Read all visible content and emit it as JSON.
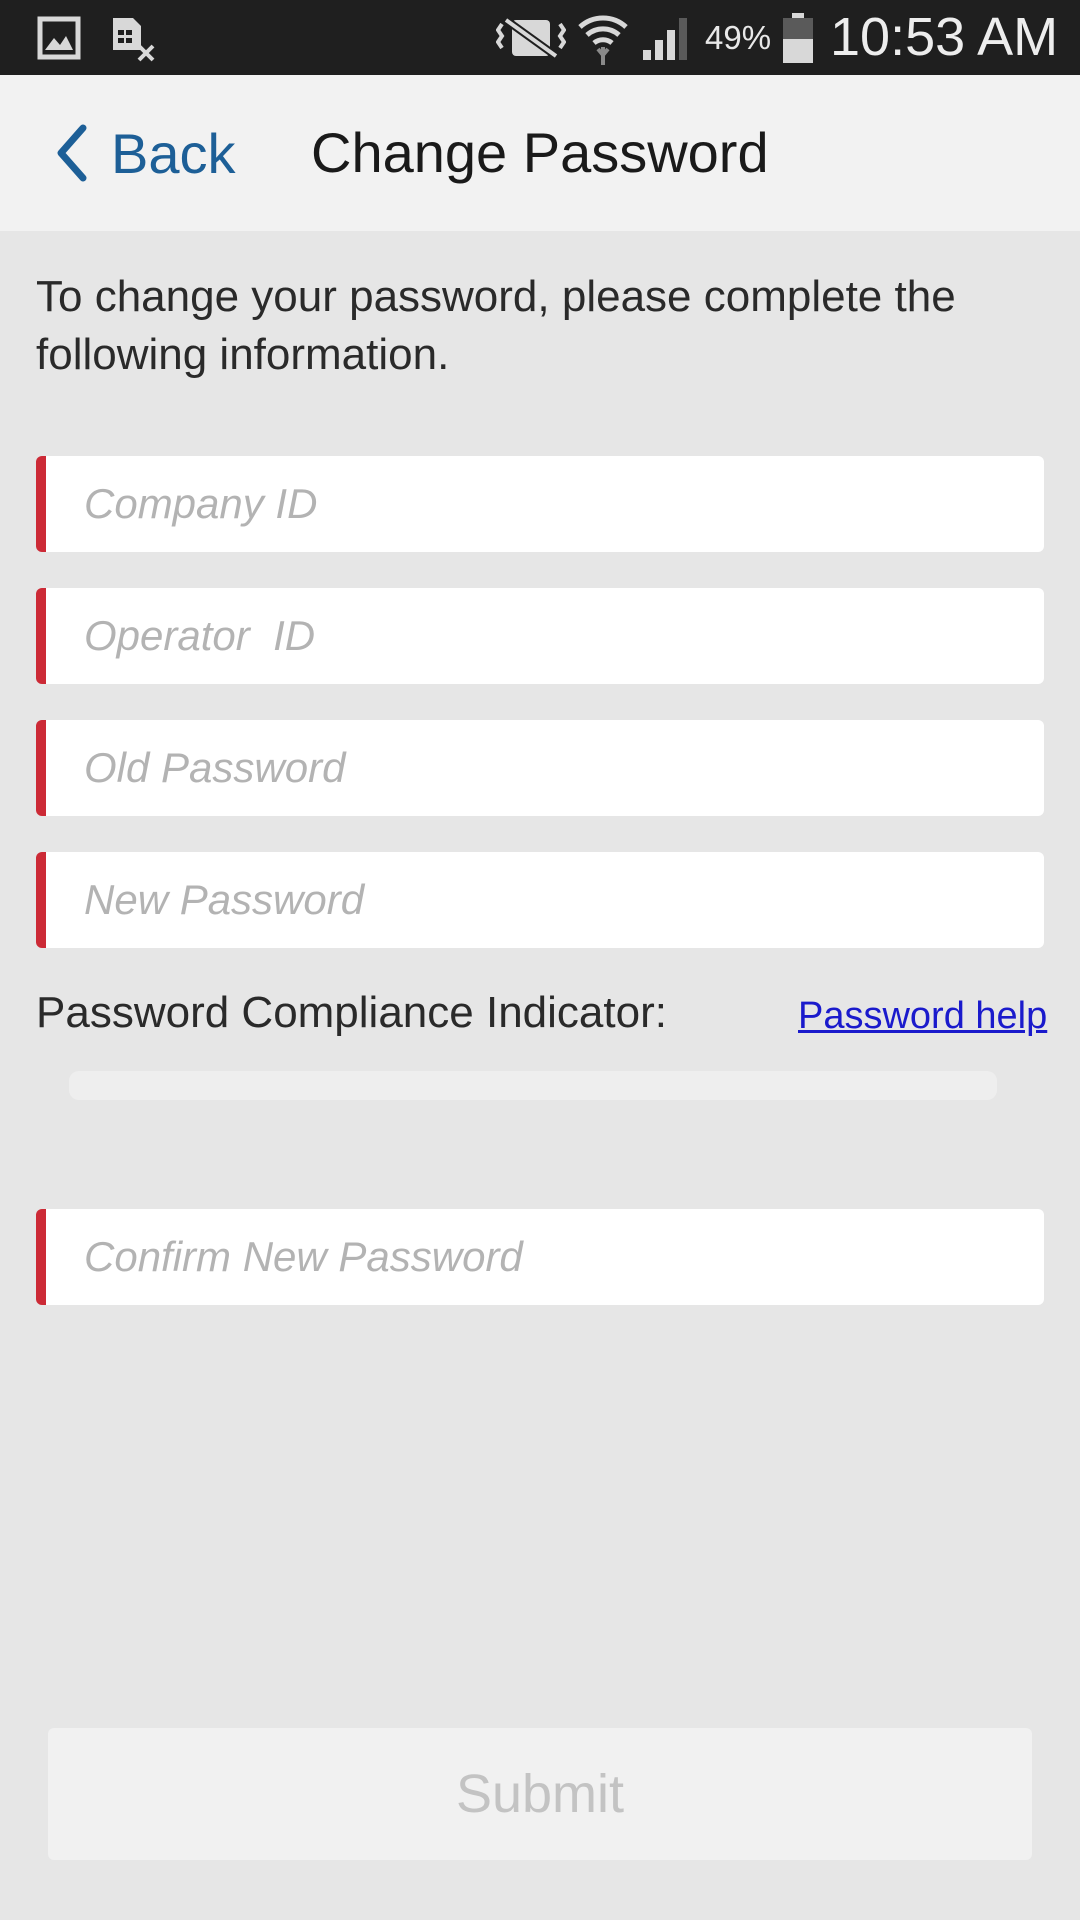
{
  "status_bar": {
    "icons": [
      "gallery-icon",
      "sim-card-blocked-icon",
      "vibrate-icon",
      "wifi-icon",
      "cellular-signal-icon",
      "battery-icon"
    ],
    "battery_percent": "49%",
    "time": "10:53 AM"
  },
  "header": {
    "back_label": "Back",
    "title": "Change Password"
  },
  "form": {
    "intro": "To change your password, please complete the following information.",
    "company_id_placeholder": "Company ID",
    "operator_id_placeholder": "Operator  ID",
    "old_password_placeholder": "Old Password",
    "new_password_placeholder": "New Password",
    "compliance_label": "Password Compliance Indicator:",
    "password_help_label": "Password help",
    "compliance_level": 0,
    "confirm_password_placeholder": "Confirm New Password",
    "submit_label": "Submit"
  },
  "colors": {
    "accent_blue": "#1d5f97",
    "required_red": "#cc2a36",
    "link_blue": "#1a1acc"
  }
}
